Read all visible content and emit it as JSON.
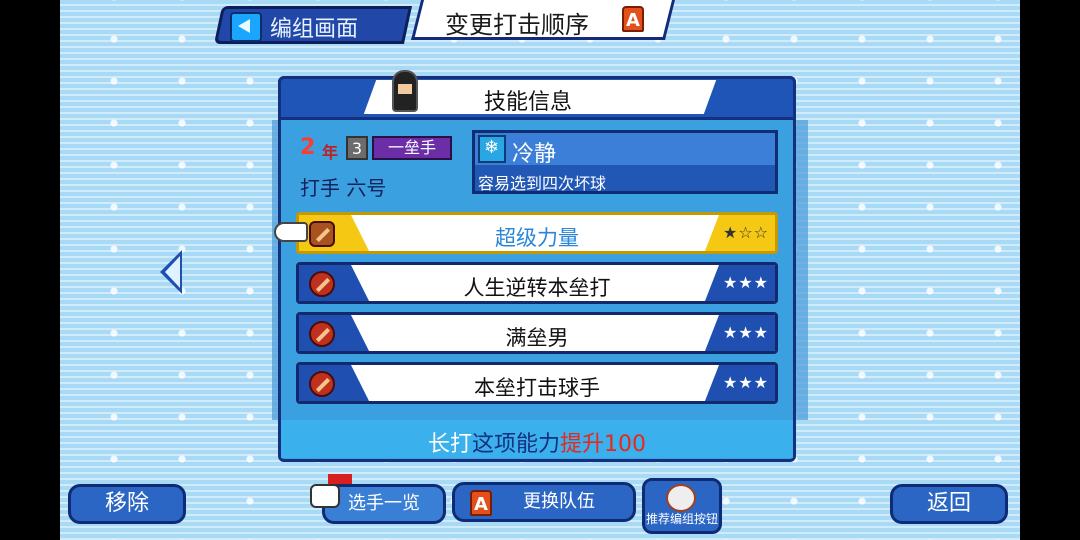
{
  "topbar": {
    "left_tag": "编组画面",
    "title": "变更打击顺序",
    "badge": "A"
  },
  "panel": {
    "title": "技能信息",
    "player": {
      "grade_num": "2",
      "grade_unit": "年",
      "level": "3",
      "position": "一垒手",
      "name": "打手 六号"
    },
    "skill": {
      "icon": "snowflake-icon",
      "name": "冷静",
      "desc": "容易选到四次坏球"
    },
    "abilities": [
      {
        "label": "超级力量",
        "stars": "★☆☆",
        "selected": true
      },
      {
        "label": "人生逆转本垒打",
        "stars": "★★★",
        "selected": false
      },
      {
        "label": "满垒男",
        "stars": "★★★",
        "selected": false
      },
      {
        "label": "本垒打击球手",
        "stars": "★★★",
        "selected": false
      }
    ],
    "footer": {
      "part1": "长打",
      "part2": "这项能力",
      "part3": "提升100"
    }
  },
  "buttons": {
    "remove": "移除",
    "player_list": "选手一览",
    "change_team": "更换队伍",
    "recommend": "推荐编组按钮",
    "back": "返回",
    "change_team_badge": "A"
  },
  "colors": {
    "bg": "#a9daf5",
    "panel": "#3aa0e0",
    "dark_blue": "#14307e",
    "accent_red": "#e8281c",
    "selected_yellow": "#f5c813"
  }
}
